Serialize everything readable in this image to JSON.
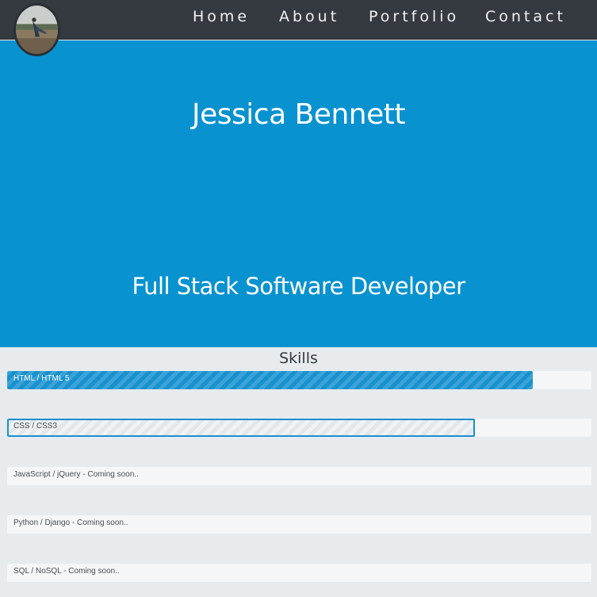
{
  "nav": {
    "links": [
      "Home",
      "About",
      "Portfolio",
      "Contact"
    ]
  },
  "hero": {
    "name": "Jessica Bennett",
    "title": "Full Stack Software Developer"
  },
  "skills": {
    "heading": "Skills",
    "items": [
      {
        "label": "HTML / HTML 5",
        "progress": 0.9,
        "style": "filled"
      },
      {
        "label": "CSS / CSS3",
        "progress": 0.8,
        "style": "outline"
      },
      {
        "label": "JavaScript / jQuery - Coming soon..",
        "progress": 0,
        "style": "none"
      },
      {
        "label": "Python / Django - Coming soon..",
        "progress": 0,
        "style": "none"
      },
      {
        "label": "SQL / NoSQL - Coming soon..",
        "progress": 0,
        "style": "none"
      }
    ]
  },
  "colors": {
    "navbar": "#343a40",
    "hero": "#0892d0",
    "page_background": "#e7ebed",
    "accent": "#1791cf"
  }
}
